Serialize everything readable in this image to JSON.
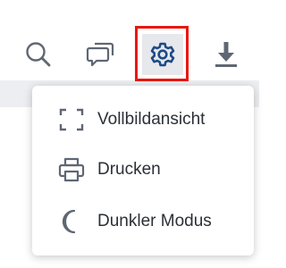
{
  "toolbar": {
    "buttons": [
      {
        "name": "search",
        "icon": "search-icon"
      },
      {
        "name": "comments",
        "icon": "comments-icon"
      },
      {
        "name": "settings",
        "icon": "gear-icon",
        "state": "active"
      },
      {
        "name": "download",
        "icon": "download-icon"
      }
    ]
  },
  "menu": {
    "items": [
      {
        "label": "Vollbildansicht",
        "icon": "fullscreen-icon"
      },
      {
        "label": "Drucken",
        "icon": "printer-icon"
      },
      {
        "label": "Dunkler Modus",
        "icon": "moon-icon"
      }
    ]
  },
  "colors": {
    "icon": "#5f6773",
    "accent_icon": "#1f4a86",
    "highlight": "#e8180f",
    "active_bg": "#e6e8ec"
  }
}
